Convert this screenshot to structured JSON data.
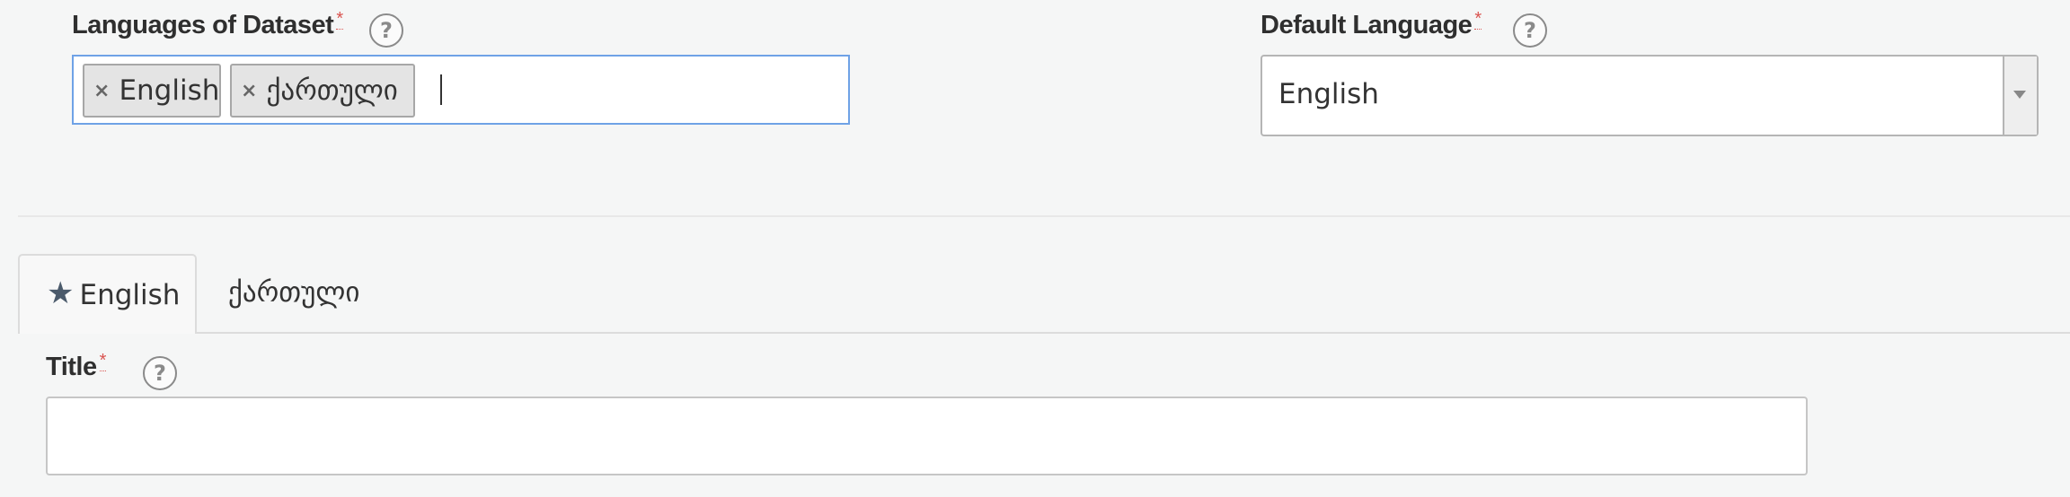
{
  "languages_field": {
    "label": "Languages of Dataset",
    "required_mark": "*",
    "help_icon": "?",
    "selected": [
      {
        "remove_icon": "×",
        "label": "English"
      },
      {
        "remove_icon": "×",
        "label": "ქართული"
      }
    ]
  },
  "default_language_field": {
    "label": "Default Language",
    "required_mark": "*",
    "help_icon": "?",
    "value": "English"
  },
  "tabs": [
    {
      "label": "English",
      "icon": "★",
      "active": true
    },
    {
      "label": "ქართული",
      "active": false
    }
  ],
  "title_field": {
    "label": "Title",
    "required_mark": "*",
    "help_icon": "?",
    "value": ""
  },
  "colors": {
    "focus_border": "#6fa2e6",
    "required": "#d9534f",
    "background": "#f5f6f6"
  }
}
